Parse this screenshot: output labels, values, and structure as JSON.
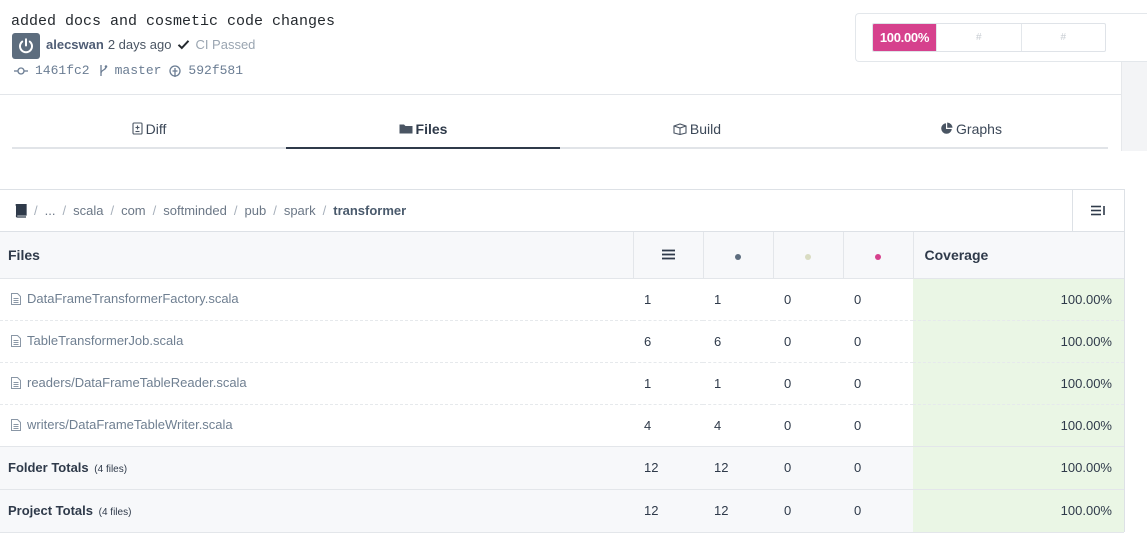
{
  "commit": {
    "message": "added docs and cosmetic code changes",
    "author": "alecswan",
    "time": "2 days ago",
    "ci_status": "CI Passed",
    "sha": "1461fc2",
    "branch": "master",
    "parent_sha": "592f581"
  },
  "coverage_summary": {
    "value": "100.00%",
    "placeholder_a": "#",
    "placeholder_b": "#",
    "accent_color": "#d6418d"
  },
  "tabs": [
    {
      "label": "Diff",
      "icon": "diff-file-icon"
    },
    {
      "label": "Files",
      "icon": "folder-icon",
      "active": true
    },
    {
      "label": "Build",
      "icon": "build-box-icon"
    },
    {
      "label": "Graphs",
      "icon": "pie-chart-icon"
    }
  ],
  "breadcrumb": {
    "root_icon": "repo-book-icon",
    "items": [
      "...",
      "scala",
      "com",
      "softminded",
      "pub",
      "spark",
      "transformer"
    ]
  },
  "table": {
    "headers": {
      "files": "Files",
      "lines_icon": "list-lines-icon",
      "hit_icon": "hit-dot-icon",
      "partial_icon": "partial-dot-icon",
      "miss_icon": "miss-dot-icon",
      "coverage": "Coverage"
    },
    "colors": {
      "hit": "#5d6d7e",
      "partial": "#d9dcc2",
      "miss": "#d6418d",
      "coverage_bg": "#eaf6e5"
    },
    "rows": [
      {
        "name": "DataFrameTransformerFactory.scala",
        "lines": "1",
        "hits": "1",
        "partials": "0",
        "misses": "0",
        "coverage": "100.00%"
      },
      {
        "name": "TableTransformerJob.scala",
        "lines": "6",
        "hits": "6",
        "partials": "0",
        "misses": "0",
        "coverage": "100.00%"
      },
      {
        "name": "readers/DataFrameTableReader.scala",
        "lines": "1",
        "hits": "1",
        "partials": "0",
        "misses": "0",
        "coverage": "100.00%"
      },
      {
        "name": "writers/DataFrameTableWriter.scala",
        "lines": "4",
        "hits": "4",
        "partials": "0",
        "misses": "0",
        "coverage": "100.00%"
      }
    ],
    "folder_totals": {
      "label": "Folder Totals",
      "note": "(4 files)",
      "lines": "12",
      "hits": "12",
      "partials": "0",
      "misses": "0",
      "coverage": "100.00%"
    },
    "project_totals": {
      "label": "Project Totals",
      "note": "(4 files)",
      "lines": "12",
      "hits": "12",
      "partials": "0",
      "misses": "0",
      "coverage": "100.00%"
    }
  }
}
